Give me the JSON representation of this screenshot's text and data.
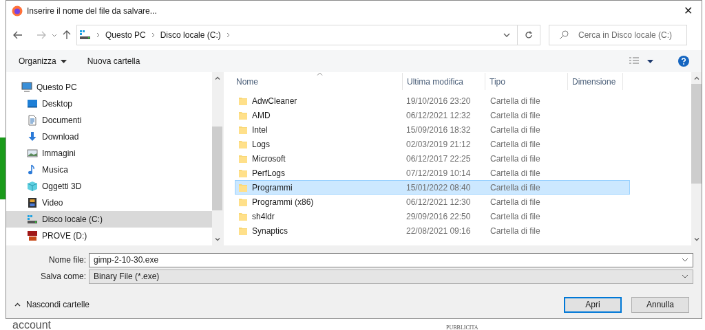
{
  "background": {
    "texts": [
      "account",
      "PUBBLICITA"
    ]
  },
  "window": {
    "title": "Inserire il nome del file da salvare...",
    "close": "✕"
  },
  "address": {
    "crumbs": [
      "Questo PC",
      "Disco locale (C:)"
    ],
    "search_placeholder": "Cerca in Disco locale (C:)"
  },
  "toolbar": {
    "organize": "Organizza",
    "new_folder": "Nuova cartella"
  },
  "sidebar": {
    "items": [
      {
        "label": "Questo PC",
        "kind": "pc",
        "selected": false,
        "children": [
          {
            "label": "Desktop",
            "kind": "desktop",
            "selected": false
          },
          {
            "label": "Documenti",
            "kind": "documents",
            "selected": false
          },
          {
            "label": "Download",
            "kind": "download",
            "selected": false
          },
          {
            "label": "Immagini",
            "kind": "pictures",
            "selected": false
          },
          {
            "label": "Musica",
            "kind": "music",
            "selected": false
          },
          {
            "label": "Oggetti 3D",
            "kind": "objects",
            "selected": false
          },
          {
            "label": "Video",
            "kind": "video",
            "selected": false
          },
          {
            "label": "Disco locale (C:)",
            "kind": "drive",
            "selected": true
          },
          {
            "label": "PROVE (D:)",
            "kind": "sd",
            "selected": false
          }
        ]
      }
    ]
  },
  "table": {
    "columns": [
      "Nome",
      "Ultima modifica",
      "Tipo",
      "Dimensione"
    ],
    "rows": [
      {
        "name": "AdwCleaner",
        "modified": "19/10/2016 23:20",
        "type": "Cartella di file",
        "selected": false
      },
      {
        "name": "AMD",
        "modified": "06/12/2021 12:32",
        "type": "Cartella di file",
        "selected": false
      },
      {
        "name": "Intel",
        "modified": "15/09/2016 18:32",
        "type": "Cartella di file",
        "selected": false
      },
      {
        "name": "Logs",
        "modified": "02/03/2019 21:12",
        "type": "Cartella di file",
        "selected": false
      },
      {
        "name": "Microsoft",
        "modified": "06/12/2017 22:25",
        "type": "Cartella di file",
        "selected": false
      },
      {
        "name": "PerfLogs",
        "modified": "07/12/2019 10:14",
        "type": "Cartella di file",
        "selected": false
      },
      {
        "name": "Programmi",
        "modified": "15/01/2022 08:40",
        "type": "Cartella di file",
        "selected": true
      },
      {
        "name": "Programmi (x86)",
        "modified": "06/12/2021 12:30",
        "type": "Cartella di file",
        "selected": false
      },
      {
        "name": "sh4ldr",
        "modified": "29/09/2016 22:50",
        "type": "Cartella di file",
        "selected": false
      },
      {
        "name": "Synaptics",
        "modified": "22/08/2021 09:16",
        "type": "Cartella di file",
        "selected": false
      }
    ]
  },
  "form": {
    "filename_label": "Nome file:",
    "filename": "gimp-2-10-30.exe",
    "type_label": "Salva come:",
    "type": "Binary File (*.exe)"
  },
  "footer": {
    "hide_folders": "Nascondi cartelle",
    "buttons": [
      "Apri",
      "Annulla"
    ]
  }
}
